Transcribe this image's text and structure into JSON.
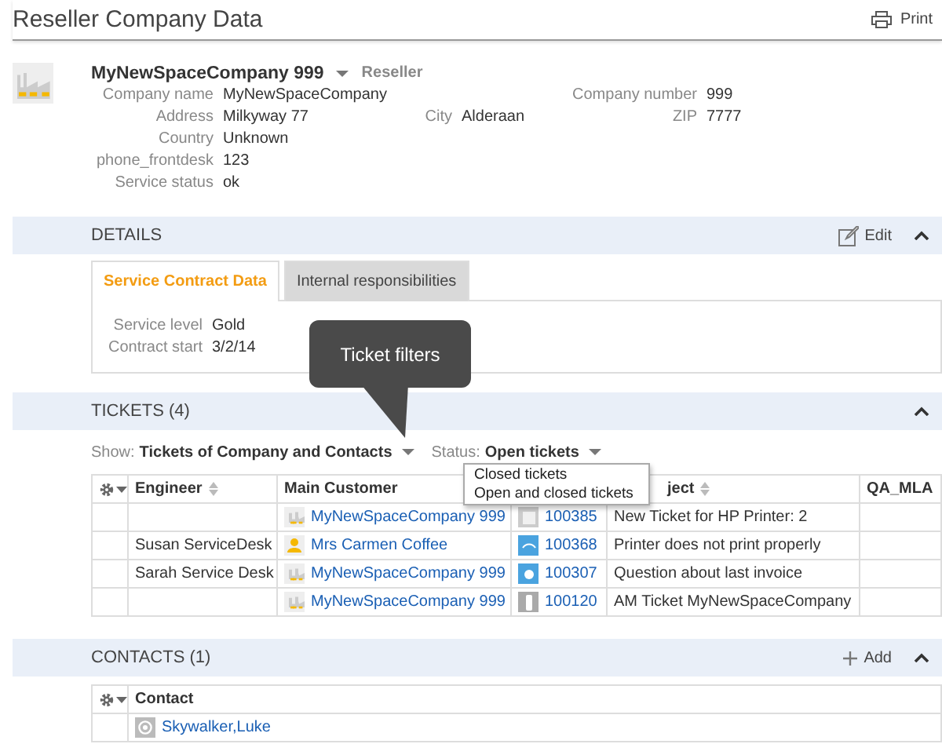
{
  "page": {
    "title": "Reseller Company Data",
    "print": "Print"
  },
  "company": {
    "name": "MyNewSpaceCompany 999",
    "type": "Reseller",
    "rows": [
      {
        "left": {
          "label": "Company name",
          "value": "MyNewSpaceCompany"
        },
        "right": {
          "label": "Company number",
          "value": "999"
        }
      },
      {
        "left": {
          "label": "Address",
          "value": "Milkyway 77"
        },
        "middle": {
          "label": "City",
          "value": "Alderaan"
        },
        "right": {
          "label": "ZIP",
          "value": "7777"
        }
      },
      {
        "left": {
          "label": "Country",
          "value": "Unknown"
        }
      },
      {
        "left": {
          "label": "phone_frontdesk",
          "value": "123"
        }
      },
      {
        "left": {
          "label": "Service status",
          "value": "ok"
        }
      }
    ]
  },
  "details": {
    "title": "DETAILS",
    "edit": "Edit",
    "tabs": [
      {
        "label": "Service Contract Data",
        "selected": true
      },
      {
        "label": "Internal responsibilities",
        "selected": false
      }
    ],
    "fields": [
      {
        "label": "Service level",
        "value": "Gold"
      },
      {
        "label": "Contract start",
        "value": "3/2/14"
      }
    ]
  },
  "tooltip": {
    "text": "Ticket filters"
  },
  "tickets": {
    "title": "TICKETS (4)",
    "show_label": "Show:",
    "show_value": "Tickets of Company and Contacts",
    "status_label": "Status:",
    "status_value": "Open tickets",
    "status_menu": [
      "Closed tickets",
      "Open and closed tickets"
    ],
    "columns": [
      {
        "label": "Engineer",
        "sortable": true
      },
      {
        "label": "Main Customer",
        "sortable": false
      },
      {},
      {
        "label": "ject",
        "sortable": true
      },
      {
        "label": "QA_MLA",
        "sortable": false
      }
    ],
    "rows": [
      {
        "engineer": "",
        "customer": {
          "kind": "company",
          "name": "MyNewSpaceCompany 999"
        },
        "ticket": {
          "kind": "note",
          "number": "100385"
        },
        "subject": "New Ticket for HP Printer: 2"
      },
      {
        "engineer": "Susan ServiceDesk",
        "customer": {
          "kind": "person",
          "name": "Mrs Carmen Coffee"
        },
        "ticket": {
          "kind": "mail",
          "number": "100368"
        },
        "subject": "Printer does not print properly"
      },
      {
        "engineer": "Sarah Service Desk",
        "customer": {
          "kind": "company",
          "name": "MyNewSpaceCompany 999"
        },
        "ticket": {
          "kind": "question",
          "number": "100307"
        },
        "subject": "Question about last invoice"
      },
      {
        "engineer": "",
        "customer": {
          "kind": "company",
          "name": "MyNewSpaceCompany 999"
        },
        "ticket": {
          "kind": "phone",
          "number": "100120"
        },
        "subject": "AM Ticket MyNewSpaceCompany"
      }
    ]
  },
  "contacts": {
    "title": "CONTACTS (1)",
    "add": "Add",
    "column": "Contact",
    "rows": [
      {
        "name": "Skywalker,Luke"
      }
    ]
  }
}
